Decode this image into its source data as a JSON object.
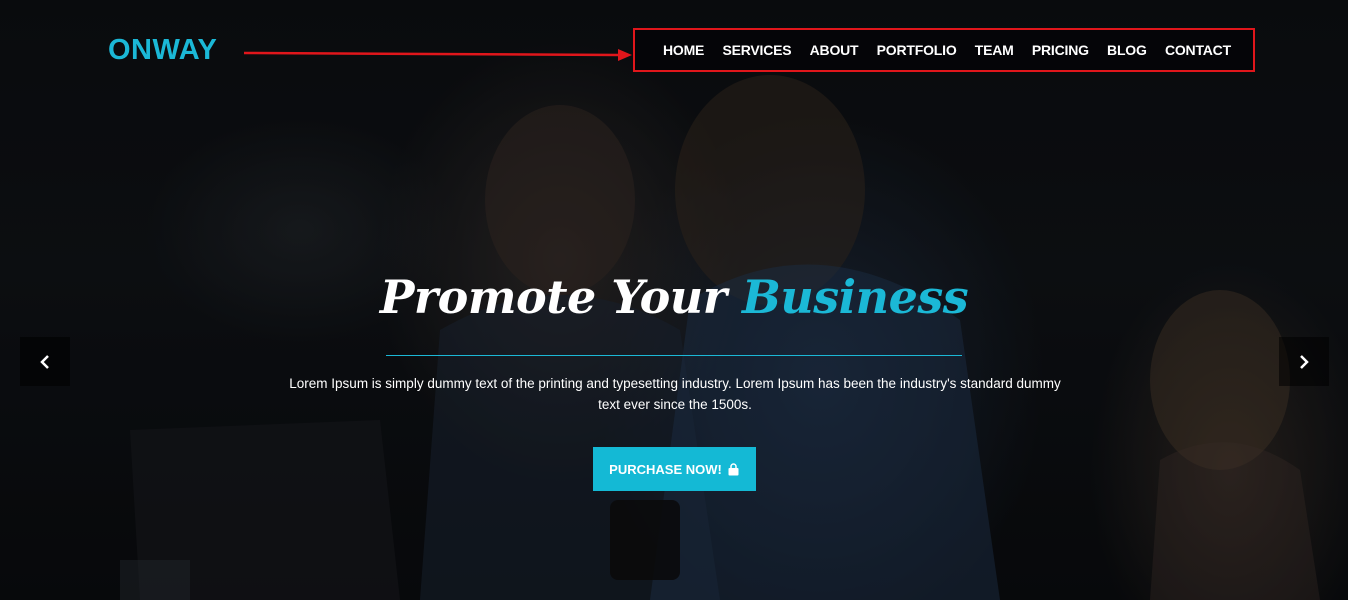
{
  "brand": {
    "name": "ONWAY",
    "accent_color": "#1bb8d6"
  },
  "nav": {
    "items": [
      {
        "label": "HOME"
      },
      {
        "label": "SERVICES"
      },
      {
        "label": "ABOUT"
      },
      {
        "label": "PORTFOLIO"
      },
      {
        "label": "TEAM"
      },
      {
        "label": "PRICING"
      },
      {
        "label": "BLOG"
      },
      {
        "label": "CONTACT"
      }
    ],
    "highlight_color": "#e0161b"
  },
  "hero": {
    "headline_main": "Promote Your",
    "headline_accent": "Business",
    "description": "Lorem Ipsum is simply dummy text of the printing and typesetting industry. Lorem Ipsum has been the industry's standard dummy text ever since the 1500s.",
    "cta_label": "PURCHASE NOW!",
    "cta_icon": "shopping-bag-icon",
    "cta_color": "#14b9d5"
  },
  "slider": {
    "prev_icon": "chevron-left-icon",
    "next_icon": "chevron-right-icon"
  }
}
